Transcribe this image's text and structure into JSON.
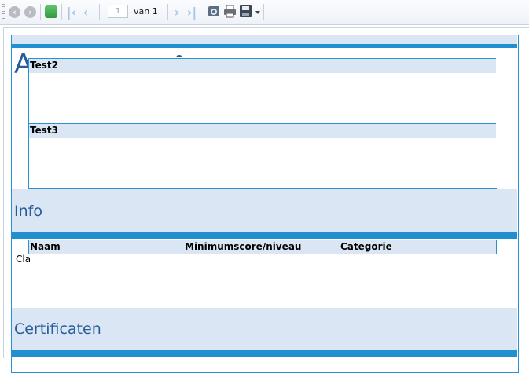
{
  "toolbar": {
    "page_number": "1",
    "page_of": "van 1",
    "icons": [
      "back-icon",
      "forward-icon",
      "refresh-icon",
      "first-page-icon",
      "previous-page-icon",
      "next-page-icon",
      "last-page-icon",
      "export-icon",
      "print-icon",
      "save-icon",
      "dropdown-arrow-icon"
    ]
  },
  "report": {
    "partial_heading": "A",
    "sections": [
      {
        "label": "Test2"
      },
      {
        "label": "Test3"
      }
    ],
    "info_title": "Info",
    "table": {
      "headers": [
        "Naam",
        "Minimumscore/niveau",
        "Categorie"
      ]
    },
    "clipped_text": "Cla",
    "certificates_title": "Certificaten"
  },
  "colors": {
    "accent": "#2090d1",
    "band": "#dae6f4",
    "title": "#275c9c"
  }
}
